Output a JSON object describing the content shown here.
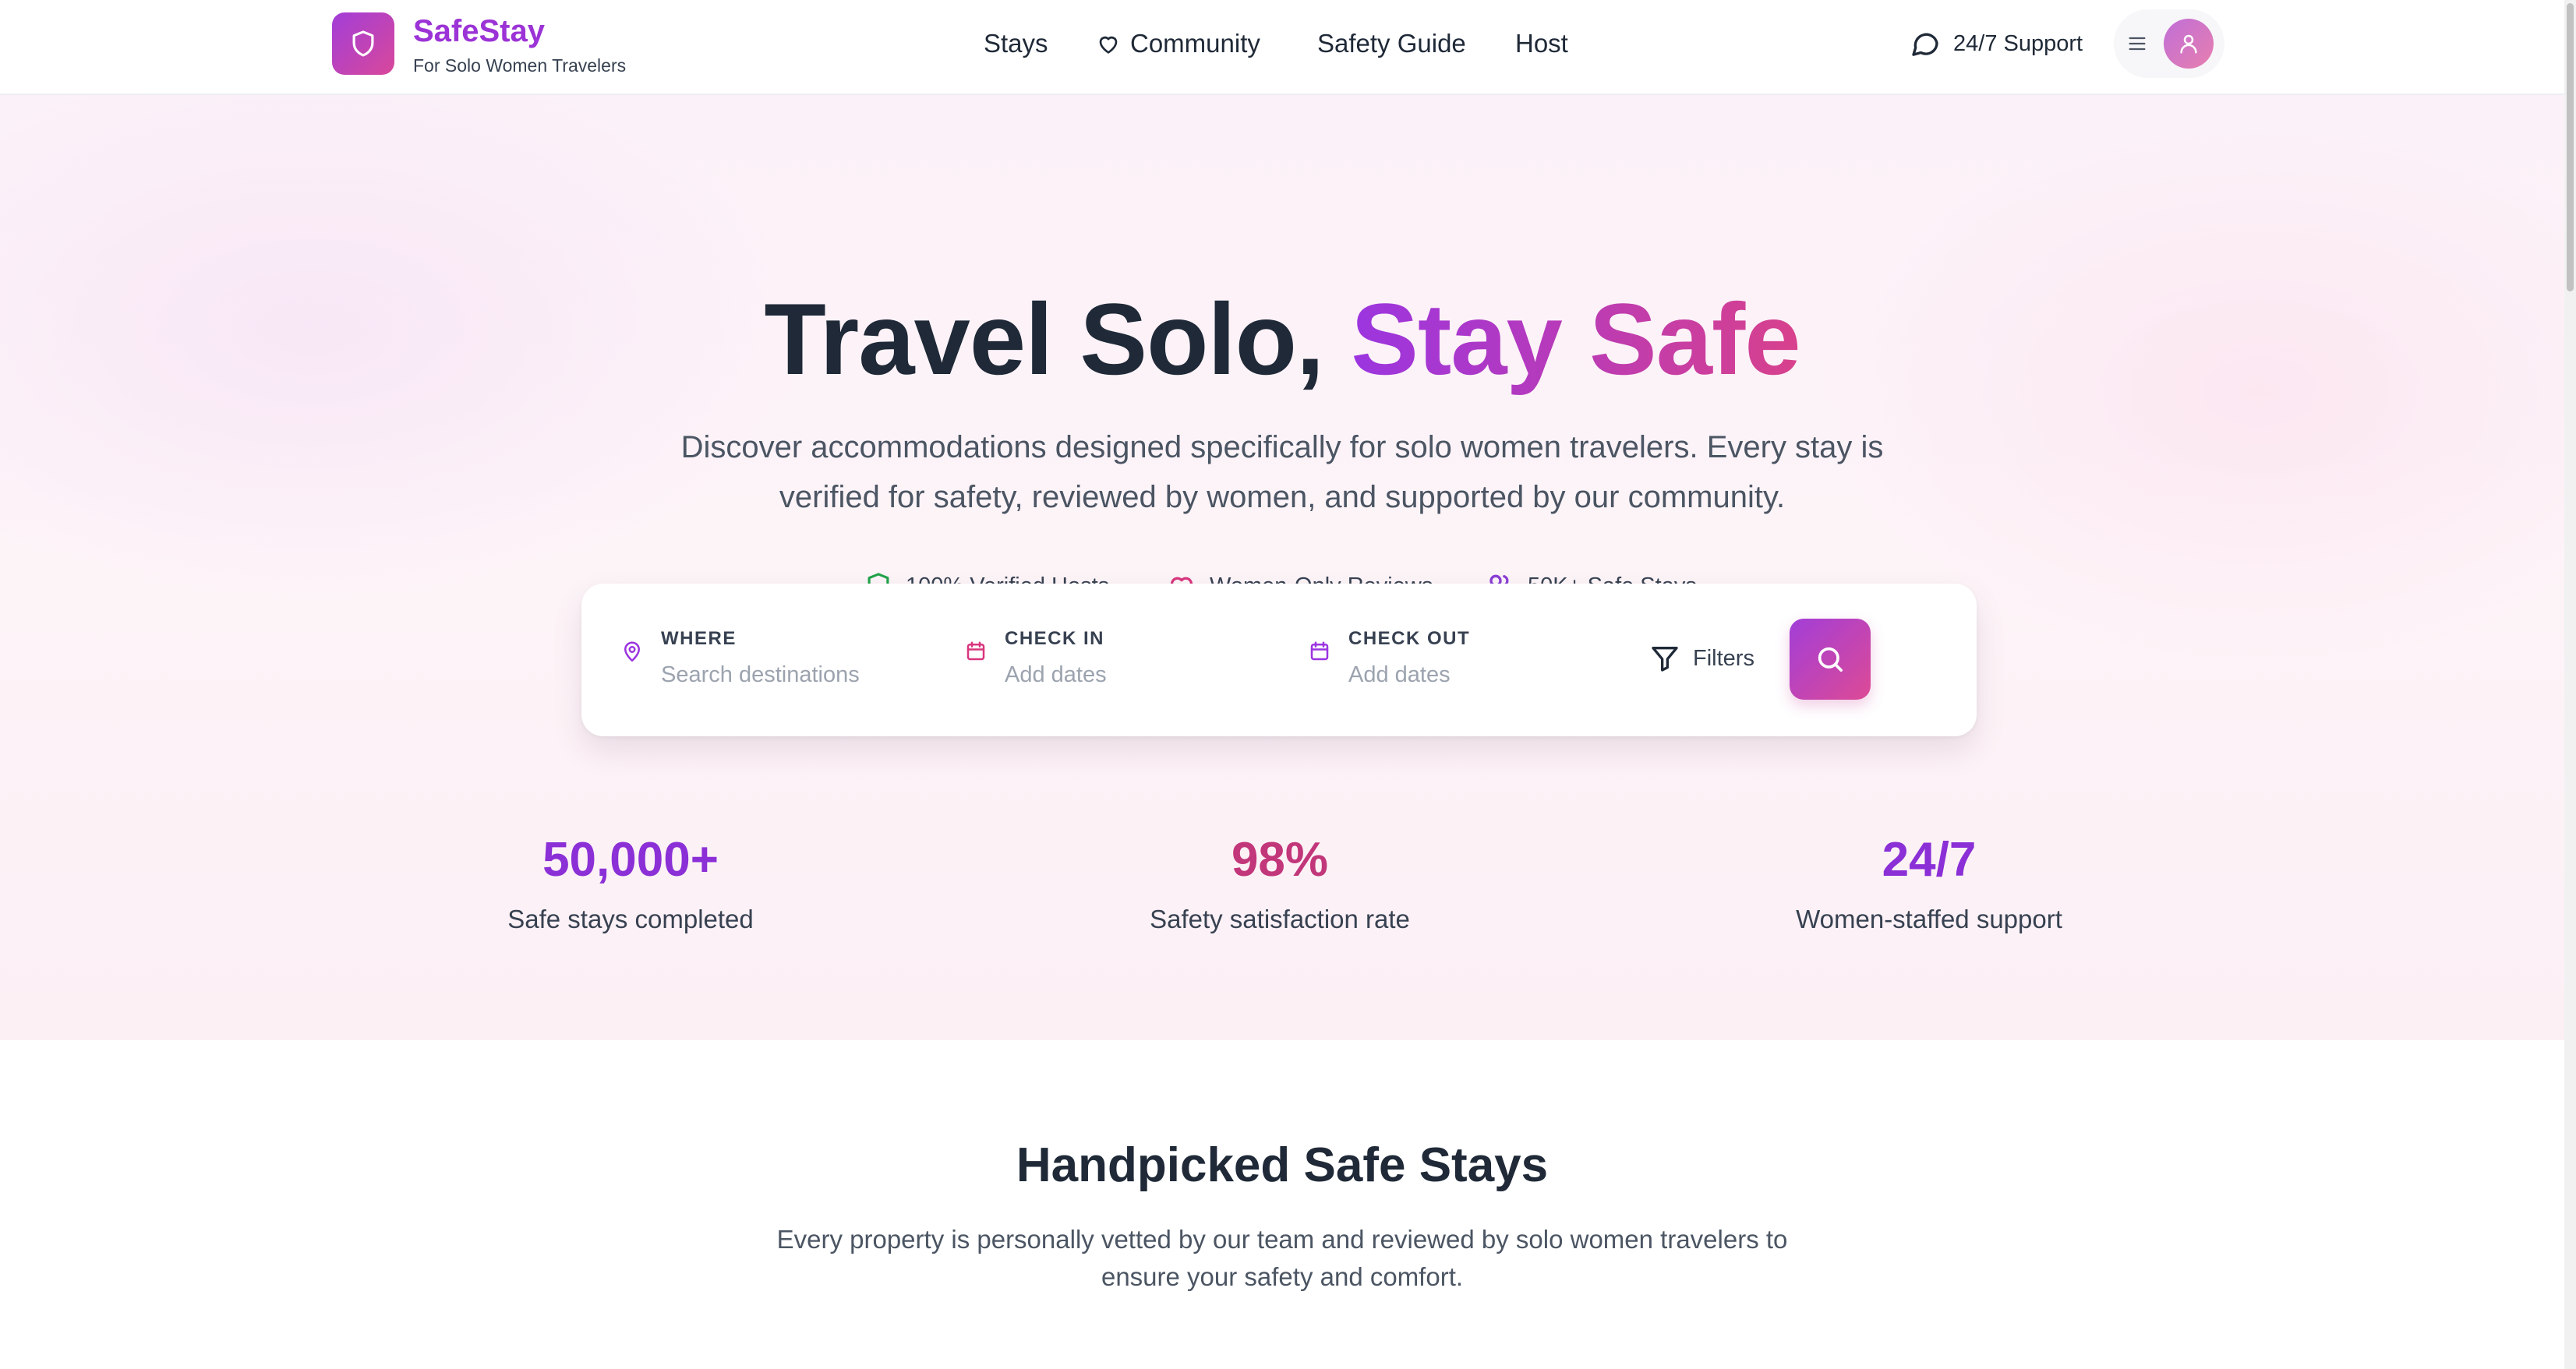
{
  "brand": {
    "name": "SafeStay",
    "tagline": "For Solo Women Travelers"
  },
  "nav": {
    "items": [
      {
        "label": "Stays",
        "icon": ""
      },
      {
        "label": "Community",
        "icon": "heart-icon"
      },
      {
        "label": "Safety Guide",
        "icon": ""
      },
      {
        "label": "Host",
        "icon": ""
      }
    ],
    "support_label": "24/7 Support"
  },
  "hero": {
    "title_plain": "Travel Solo,",
    "title_accent": "Stay Safe",
    "subtitle": "Discover accommodations designed specifically for solo women travelers. Every stay is verified for safety, reviewed by women, and supported by our community.",
    "features": [
      {
        "label": "100% Verified Hosts",
        "icon": "shield-icon"
      },
      {
        "label": "Women-Only Reviews",
        "icon": "heart-icon"
      },
      {
        "label": "50K+ Safe Stays",
        "icon": "users-icon"
      }
    ]
  },
  "search": {
    "where_label": "WHERE",
    "where_placeholder": "Search destinations",
    "checkin_label": "CHECK IN",
    "checkin_placeholder": "Add dates",
    "checkout_label": "CHECK OUT",
    "checkout_placeholder": "Add dates",
    "filters_label": "Filters"
  },
  "stats": [
    {
      "value": "50,000+",
      "label": "Safe stays completed",
      "color": "#8b2fd6"
    },
    {
      "value": "98%",
      "label": "Safety satisfaction rate",
      "color": "#c2367a"
    },
    {
      "value": "24/7",
      "label": "Women-staffed support",
      "color": "#8b2fd6"
    }
  ],
  "section": {
    "title": "Handpicked Safe Stays",
    "subtitle": "Every property is personally vetted by our team and reviewed by solo women travelers to ensure your safety and comfort."
  },
  "colors": {
    "brand_purple": "#9b33d6",
    "brand_pink": "#d9489a",
    "text_dark": "#1f2937",
    "muted": "#9ca3af"
  }
}
